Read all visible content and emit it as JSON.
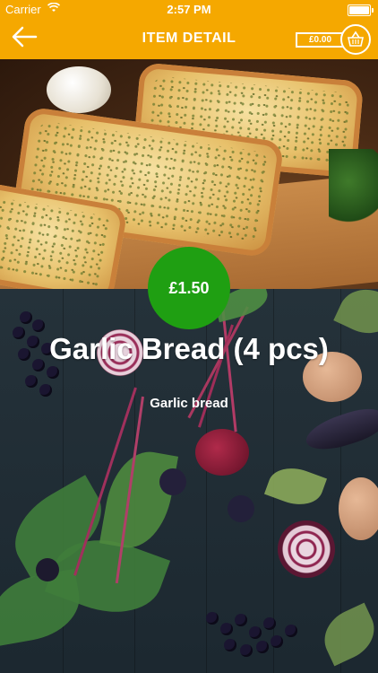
{
  "status_bar": {
    "carrier": "Carrier",
    "time": "2:57 PM"
  },
  "header": {
    "title": "ITEM DETAIL",
    "cart_total": "£0.00"
  },
  "item": {
    "price": "£1.50",
    "name": "Garlic Bread (4 pcs)",
    "description": "Garlic bread"
  },
  "colors": {
    "header": "#f5a800",
    "price_badge": "#1f9f12"
  }
}
